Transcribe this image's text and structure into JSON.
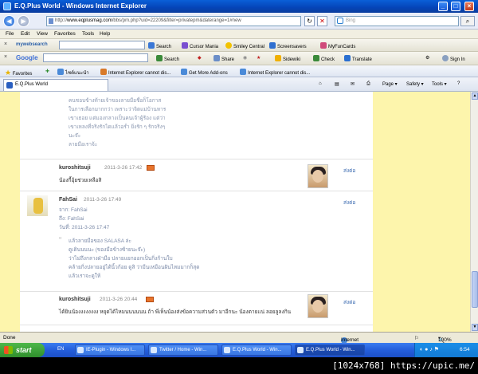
{
  "window": {
    "title": "E.Q.Plus World - Windows Internet Explorer",
    "minimize": "_",
    "maximize": "□",
    "close": "×"
  },
  "address_bar": {
    "url_host": "www.eqplusmag.com",
    "url_prefix": "http://",
    "url_rest": "/bbs/pm.php?uid=22209&filter=privatepm&daterange=1#new",
    "refresh": "↻",
    "stop": "✕",
    "search_placeholder": "Bing",
    "search_btn": "⌕"
  },
  "menu": [
    "File",
    "Edit",
    "View",
    "Favorites",
    "Tools",
    "Help"
  ],
  "toolbar1": {
    "brand": "mywebsearch",
    "search_label": "Search",
    "items": [
      "Cursor Mania",
      "Smiley Central",
      "Screensavers",
      "MyFunCards"
    ]
  },
  "toolbar2": {
    "brand": "Google",
    "search_label": "Search",
    "items": [
      "Share",
      "Sidewiki",
      "Check",
      "Translate",
      "Sign In"
    ]
  },
  "favorites": {
    "label": "Favorites",
    "items": [
      "ไซต์แนะนำ",
      "Internet Explorer cannot dis...",
      "Get More Add-ons",
      "Internet Explorer cannot dis..."
    ]
  },
  "tab": {
    "label": "E.Q.Plus World",
    "tools": [
      "Page",
      "Safety",
      "Tools"
    ]
  },
  "posts": {
    "top_lines": [
      "คนชอบข้างท้ายเจ้าของลายมือชื่อก็โอกาส",
      "ในการเลือกมากกว่า เพราะว่าจิตแม่บ้านหาร",
      "เขาเธอย แต่มองกลางเป็นคนเจ้าผู้ร้อง แต่ว่า",
      "เขาเหลงที่จริงรักไดแล้วอร่ำ ยิ่งรัก ๆ รักจริงๆ",
      "นะจ๊ะ",
      "ลายมือเราจ้ะ"
    ],
    "p1": {
      "user": "kuroshitsuji",
      "date": "2011-3-26 17:42",
      "text": "น้องกี้อุ้ยช่วยเหลือสิ",
      "reply": "ส่งต่อ"
    },
    "p2": {
      "user": "FahSai",
      "date": "2011-3-26 17:49",
      "from": "จาก: FahSai",
      "to": "ถึง: FahSai",
      "when": "วันที่: 2011-3-26 17:47",
      "quote": [
        "แล้วลายมือของ SALASA ล่ะ",
        "ดูเดินนนนะ (ของมือข้างซ้ายนะจ๊ะ)",
        "ว่าไม่ถึงกลางฝ่ามือ ปลายแยกออกเป็นกิ่งก้านใบ",
        "คล้ายกิ่งปลายอยู่ได้นิ้วก้อย ดูสิ ว่ามีนเหมือนฝันไหมมากก็สุด",
        "แล้วเราจะดูให้"
      ],
      "reply": "ส่งต่อ"
    },
    "p3": {
      "user": "kuroshitsuji",
      "date": "2011-3-26 20:44",
      "text": "ได้ยินน้องงงงงงงง หยุดได้ไหมนนนนนน ถ้า พี่เห็นน้องส่งข้อความส่วนตัว มาอีกนะ น้องตายแน่ ลอยลูลงกิน",
      "reply": "ส่งต่อ"
    }
  },
  "status": {
    "left": "Done",
    "zone": "Internet",
    "zoom": "100%"
  },
  "taskbar": {
    "start": "start",
    "lang": "EN",
    "tasks": [
      "IE-Plugin - Windows I...",
      "Twitter / Home - Win...",
      "E.Q.Plus World - Win...",
      "E.Q.Plus World - Win..."
    ],
    "clock": "6:54"
  },
  "caption": "[1024x768] https://upic.me/"
}
